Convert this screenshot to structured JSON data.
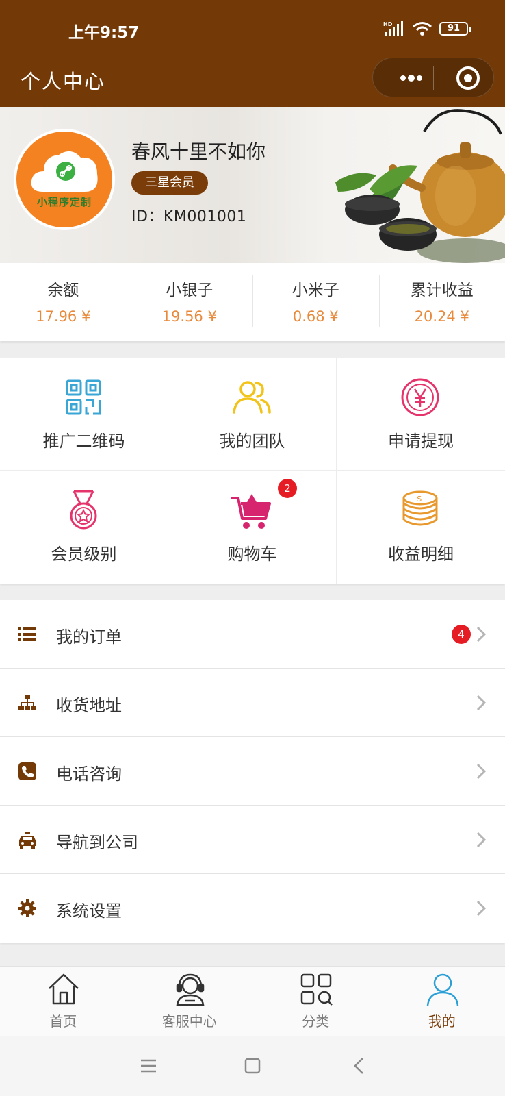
{
  "status_bar": {
    "time": "上午9:57",
    "signal_label": "HD",
    "battery": "91"
  },
  "nav": {
    "title": "个人中心",
    "more_icon": "more-dots-icon",
    "close_icon": "target-icon"
  },
  "profile": {
    "name": "春风十里不如你",
    "level_badge": "三星会员",
    "id": "ID：KM001001",
    "avatar_text": "小程序定制"
  },
  "stats": [
    {
      "label": "余额",
      "value": "17.96 ¥"
    },
    {
      "label": "小银子",
      "value": "19.56 ¥"
    },
    {
      "label": "小米子",
      "value": "0.68 ¥"
    },
    {
      "label": "累计收益",
      "value": "20.24 ¥"
    }
  ],
  "grid": [
    {
      "label": "推广二维码",
      "icon": "qr-code-icon",
      "color": "#3aa6d6"
    },
    {
      "label": "我的团队",
      "icon": "team-icon",
      "color": "#f2c319"
    },
    {
      "label": "申请提现",
      "icon": "yen-coin-icon",
      "color": "#e5336b"
    },
    {
      "label": "会员级别",
      "icon": "medal-icon",
      "color": "#e5336b"
    },
    {
      "label": "购物车",
      "icon": "cart-icon",
      "color": "#d6246e",
      "badge": "2"
    },
    {
      "label": "收益明细",
      "icon": "coins-icon",
      "color": "#e8992e"
    }
  ],
  "menu": [
    {
      "label": "我的订单",
      "icon": "list-icon",
      "badge": "4"
    },
    {
      "label": "收货地址",
      "icon": "sitemap-icon"
    },
    {
      "label": "电话咨询",
      "icon": "phone-icon"
    },
    {
      "label": "导航到公司",
      "icon": "taxi-icon"
    },
    {
      "label": "系统设置",
      "icon": "gear-icon"
    }
  ],
  "tabbar": [
    {
      "label": "首页",
      "icon": "home-icon"
    },
    {
      "label": "客服中心",
      "icon": "customer-service-icon"
    },
    {
      "label": "分类",
      "icon": "category-icon"
    },
    {
      "label": "我的",
      "icon": "user-icon",
      "active": true
    }
  ],
  "colors": {
    "brand": "#733a08",
    "accent_value": "#e88a3c",
    "badge_red": "#e51c23",
    "active_tab_icon": "#2b9fd6"
  }
}
